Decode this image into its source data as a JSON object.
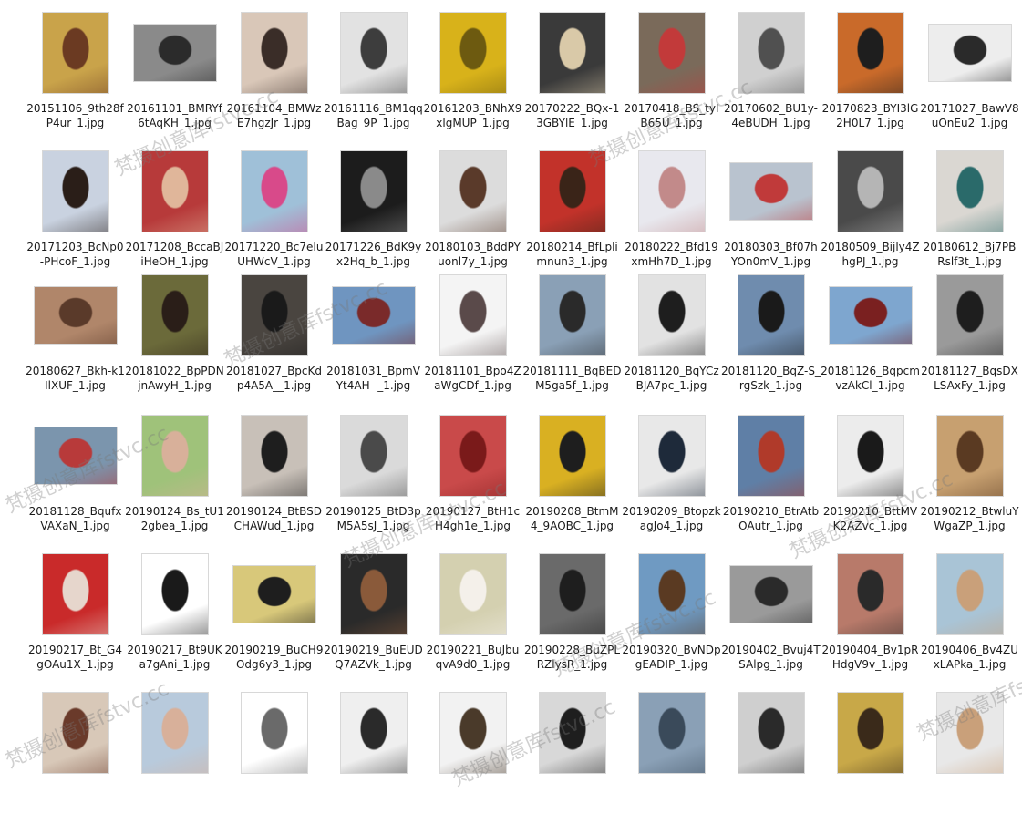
{
  "watermark": "梵摄创意库fstvc.cc",
  "files": [
    {
      "name": "20151106_9th28fP4ur_1.jpg",
      "shape": "portrait",
      "colors": [
        "#c9a34a",
        "#6b3a22"
      ]
    },
    {
      "name": "20161101_BMRYf6tAqKH_1.jpg",
      "shape": "landscape",
      "colors": [
        "#8a8a8a",
        "#2b2b2b"
      ]
    },
    {
      "name": "20161104_BMWzE7hgzJr_1.jpg",
      "shape": "portrait",
      "colors": [
        "#d9c7b8",
        "#3a2d28"
      ]
    },
    {
      "name": "20161116_BM1qqBag_9P_1.jpg",
      "shape": "portrait",
      "colors": [
        "#e2e2e2",
        "#3d3d3d"
      ]
    },
    {
      "name": "20161203_BNhX9xlgMUP_1.jpg",
      "shape": "portrait",
      "colors": [
        "#d8b21a",
        "#6d5a10"
      ]
    },
    {
      "name": "20170222_BQx-13GBYlE_1.jpg",
      "shape": "portrait",
      "colors": [
        "#3a3a3a",
        "#d9c9a8"
      ]
    },
    {
      "name": "20170418_BS_tyIB65U_1.jpg",
      "shape": "portrait",
      "colors": [
        "#7a6a5a",
        "#c23a3a"
      ]
    },
    {
      "name": "20170602_BU1y-4eBUDH_1.jpg",
      "shape": "portrait",
      "colors": [
        "#d0d0d0",
        "#505050"
      ]
    },
    {
      "name": "20170823_BYI3lG2H0L7_1.jpg",
      "shape": "portrait",
      "colors": [
        "#c96a2a",
        "#1e1e1e"
      ]
    },
    {
      "name": "20171027_BawV8uOnEu2_1.jpg",
      "shape": "landscape",
      "colors": [
        "#ededed",
        "#2a2a2a"
      ]
    },
    {
      "name": "20171203_BcNp0-PHcoF_1.jpg",
      "shape": "portrait",
      "colors": [
        "#c9d2e0",
        "#2a1e18"
      ]
    },
    {
      "name": "20171208_BccaBJiHeOH_1.jpg",
      "shape": "portrait",
      "colors": [
        "#b73a3a",
        "#e0b69a"
      ]
    },
    {
      "name": "20171220_Bc7eIuUHWcV_1.jpg",
      "shape": "portrait",
      "colors": [
        "#9fc0d8",
        "#d84a8a"
      ]
    },
    {
      "name": "20171226_BdK9yx2Hq_b_1.jpg",
      "shape": "portrait",
      "colors": [
        "#1c1c1c",
        "#8a8a8a"
      ]
    },
    {
      "name": "20180103_BddPYuonl7y_1.jpg",
      "shape": "portrait",
      "colors": [
        "#dcdcdc",
        "#5a3a2a"
      ]
    },
    {
      "name": "20180214_BfLplimnun3_1.jpg",
      "shape": "portrait",
      "colors": [
        "#c2322a",
        "#3a2418"
      ]
    },
    {
      "name": "20180222_Bfd19xmHh7D_1.jpg",
      "shape": "portrait",
      "colors": [
        "#e8e8ee",
        "#c28a8a"
      ]
    },
    {
      "name": "20180303_Bf07hYOn0mV_1.jpg",
      "shape": "landscape",
      "colors": [
        "#b9c3cf",
        "#c03a3a"
      ]
    },
    {
      "name": "20180509_Bijly4ZhgPJ_1.jpg",
      "shape": "portrait",
      "colors": [
        "#4a4a4a",
        "#b5b5b5"
      ]
    },
    {
      "name": "20180612_Bj7PBRslf3t_1.jpg",
      "shape": "portrait",
      "colors": [
        "#dad7d2",
        "#2a6a6a"
      ]
    },
    {
      "name": "20180627_Bkh-k1IlXUF_1.jpg",
      "shape": "landscape",
      "colors": [
        "#b0866a",
        "#5a3a2a"
      ]
    },
    {
      "name": "20181022_BpPDNjnAwyH_1.jpg",
      "shape": "portrait",
      "colors": [
        "#6b6a3a",
        "#2a1e18"
      ]
    },
    {
      "name": "20181027_BpcKdp4A5A__1.jpg",
      "shape": "portrait",
      "colors": [
        "#4a4540",
        "#1a1a1a"
      ]
    },
    {
      "name": "20181031_BpmVYt4AH--_1.jpg",
      "shape": "landscape",
      "colors": [
        "#6f95c0",
        "#7a2a2a"
      ]
    },
    {
      "name": "20181101_Bpo4ZaWgCDf_1.jpg",
      "shape": "portrait",
      "colors": [
        "#f4f4f4",
        "#5a4a4a"
      ]
    },
    {
      "name": "20181111_BqBEDM5ga5f_1.jpg",
      "shape": "portrait",
      "colors": [
        "#8aa0b6",
        "#2a2a2a"
      ]
    },
    {
      "name": "20181120_BqYCzBJA7pc_1.jpg",
      "shape": "portrait",
      "colors": [
        "#e2e2e2",
        "#1e1e1e"
      ]
    },
    {
      "name": "20181120_BqZ-S_rgSzk_1.jpg",
      "shape": "portrait",
      "colors": [
        "#6f8cae",
        "#1a1a1a"
      ]
    },
    {
      "name": "20181126_BqpcmvzAkCl_1.jpg",
      "shape": "landscape",
      "colors": [
        "#7ea6cf",
        "#7a2020"
      ]
    },
    {
      "name": "20181127_BqsDXLSAxFy_1.jpg",
      "shape": "portrait",
      "colors": [
        "#9a9a9a",
        "#1e1e1e"
      ]
    },
    {
      "name": "20181128_BqufxVAXaN_1.jpg",
      "shape": "landscape",
      "colors": [
        "#7b95ad",
        "#b83a3a"
      ]
    },
    {
      "name": "20190124_Bs_tU12gbea_1.jpg",
      "shape": "portrait",
      "colors": [
        "#9fc27a",
        "#d8b09a"
      ]
    },
    {
      "name": "20190124_BtBSDCHAWud_1.jpg",
      "shape": "portrait",
      "colors": [
        "#c8c0b8",
        "#1e1e1e"
      ]
    },
    {
      "name": "20190125_BtD3pM5A5sJ_1.jpg",
      "shape": "portrait",
      "colors": [
        "#dadada",
        "#4a4a4a"
      ]
    },
    {
      "name": "20190127_BtH1cH4gh1e_1.jpg",
      "shape": "portrait",
      "colors": [
        "#c94a4a",
        "#7a1a1a"
      ]
    },
    {
      "name": "20190208_BtmM4_9AOBC_1.jpg",
      "shape": "portrait",
      "colors": [
        "#d9b022",
        "#1e1e1e"
      ]
    },
    {
      "name": "20190209_BtopzkagJo4_1.jpg",
      "shape": "portrait",
      "colors": [
        "#e8e8e8",
        "#1e2a3a"
      ]
    },
    {
      "name": "20190210_BtrAtbOAutr_1.jpg",
      "shape": "portrait",
      "colors": [
        "#5f7fa6",
        "#b03a2a"
      ]
    },
    {
      "name": "20190210_BttMVK2AZvc_1.jpg",
      "shape": "portrait",
      "colors": [
        "#ececec",
        "#1a1a1a"
      ]
    },
    {
      "name": "20190212_BtwluYWgaZP_1.jpg",
      "shape": "portrait",
      "colors": [
        "#c7a070",
        "#5a3a22"
      ]
    },
    {
      "name": "20190217_Bt_G4gOAu1X_1.jpg",
      "shape": "portrait",
      "colors": [
        "#c92a2a",
        "#e6d6cc"
      ]
    },
    {
      "name": "20190217_Bt9UKa7gAni_1.jpg",
      "shape": "portrait",
      "colors": [
        "#ffffff",
        "#1a1a1a"
      ]
    },
    {
      "name": "20190219_BuCH9Odg6y3_1.jpg",
      "shape": "landscape",
      "colors": [
        "#d8c87a",
        "#1e1e1e"
      ]
    },
    {
      "name": "20190219_BuEUDQ7AZVk_1.jpg",
      "shape": "portrait",
      "colors": [
        "#2a2a2a",
        "#8a5a3a"
      ]
    },
    {
      "name": "20190221_BuJbuqvA9d0_1.jpg",
      "shape": "portrait",
      "colors": [
        "#d4d0b0",
        "#f4f0ea"
      ]
    },
    {
      "name": "20190228_BuZPLRZlysR_1.jpg",
      "shape": "portrait",
      "colors": [
        "#6a6a6a",
        "#1e1e1e"
      ]
    },
    {
      "name": "20190320_BvNDpgEADIP_1.jpg",
      "shape": "portrait",
      "colors": [
        "#6f9ac2",
        "#5a3a22"
      ]
    },
    {
      "name": "20190402_Bvuj4TSAlpg_1.jpg",
      "shape": "landscape",
      "colors": [
        "#9a9a9a",
        "#2a2a2a"
      ]
    },
    {
      "name": "20190404_Bv1pRHdgV9v_1.jpg",
      "shape": "portrait",
      "colors": [
        "#b87a6a",
        "#2a2a2a"
      ]
    },
    {
      "name": "20190406_Bv4ZUxLAPka_1.jpg",
      "shape": "portrait",
      "colors": [
        "#a9c4d6",
        "#c9a07a"
      ]
    },
    {
      "name": "",
      "shape": "portrait",
      "colors": [
        "#d8c8b8",
        "#6a3a2a"
      ]
    },
    {
      "name": "",
      "shape": "portrait",
      "colors": [
        "#b8cadc",
        "#d8b09a"
      ]
    },
    {
      "name": "",
      "shape": "portrait",
      "colors": [
        "#ffffff",
        "#6a6a6a"
      ]
    },
    {
      "name": "",
      "shape": "portrait",
      "colors": [
        "#efefef",
        "#2a2a2a"
      ]
    },
    {
      "name": "",
      "shape": "portrait",
      "colors": [
        "#f2f2f2",
        "#4a3a2a"
      ]
    },
    {
      "name": "",
      "shape": "portrait",
      "colors": [
        "#d8d8d8",
        "#1e1e1e"
      ]
    },
    {
      "name": "",
      "shape": "portrait",
      "colors": [
        "#8aa0b6",
        "#3a4a5a"
      ]
    },
    {
      "name": "",
      "shape": "portrait",
      "colors": [
        "#cfcfcf",
        "#2a2a2a"
      ]
    },
    {
      "name": "",
      "shape": "portrait",
      "colors": [
        "#c8a848",
        "#3a2a1a"
      ]
    },
    {
      "name": "",
      "shape": "portrait",
      "colors": [
        "#e8e8e8",
        "#c9a07a"
      ]
    }
  ]
}
